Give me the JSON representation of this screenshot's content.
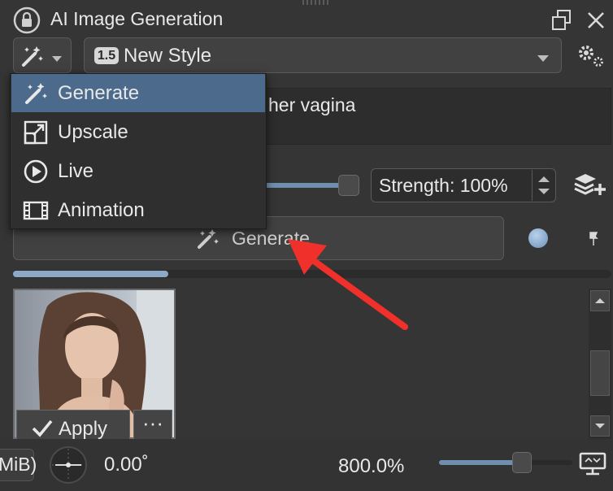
{
  "panel": {
    "title": "AI Image Generation"
  },
  "style_select": {
    "badge": "1.5",
    "label": "New Style"
  },
  "prompt": {
    "text": "her vagina"
  },
  "strength": {
    "label": "Strength: 100%",
    "value": 1.0
  },
  "generate_button": {
    "label": "Generate"
  },
  "progress": {
    "value": 0.26
  },
  "result": {
    "apply_label": "Apply",
    "more_label": "···"
  },
  "statusbar": {
    "left_text": "MiB)",
    "angle": "0.00˚",
    "zoom": "800.0%",
    "zoom_slider": 0.62
  },
  "mode_menu": {
    "items": [
      {
        "label": "Generate",
        "icon": "magic-wand-icon",
        "selected": true
      },
      {
        "label": "Upscale",
        "icon": "upscale-icon",
        "selected": false
      },
      {
        "label": "Live",
        "icon": "play-circle-icon",
        "selected": false
      },
      {
        "label": "Animation",
        "icon": "film-icon",
        "selected": false
      }
    ]
  },
  "colors": {
    "accent": "#4b6a8c",
    "annotation_arrow": "#f0302a",
    "background": "#353535"
  }
}
